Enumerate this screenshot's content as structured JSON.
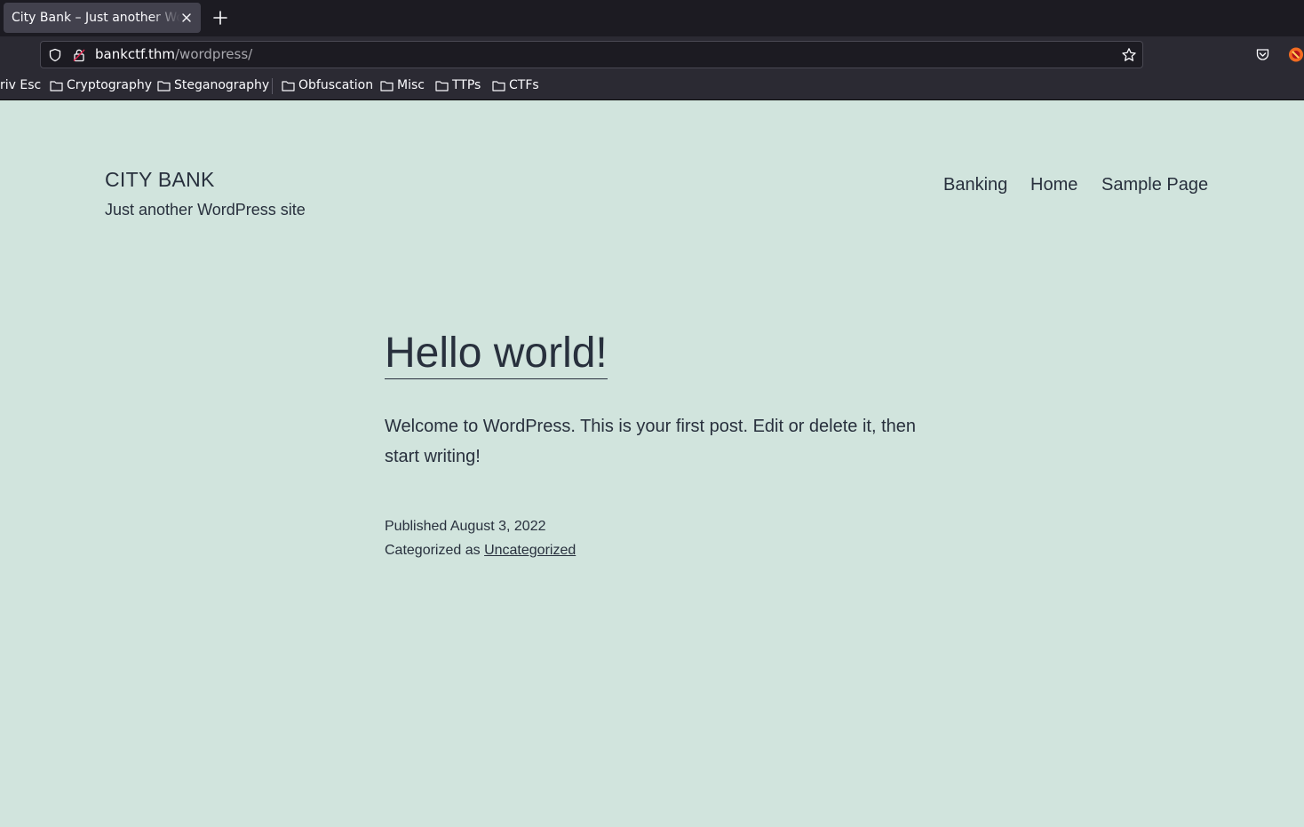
{
  "browser": {
    "tab": {
      "title": "City Bank – Just another WordPress site"
    },
    "url": {
      "host": "bankctf.thm",
      "path": "/wordpress/"
    },
    "bookmarks": [
      "riv Esc",
      "Cryptography",
      "Steganography",
      "Obfuscation",
      "Misc",
      "TTPs",
      "CTFs"
    ],
    "icons": {
      "tab_close": "close-icon",
      "new_tab": "plus-icon",
      "tracking": "shield-icon",
      "security": "lock-icon",
      "bookmark_page": "star-icon",
      "pocket": "pocket-icon",
      "extension": "extension-icon",
      "bookmark_folder": "folder-icon"
    },
    "colors": {
      "tabbar": "#1c1b22",
      "toolbar": "#2b2a33",
      "active_tab": "#42414d"
    }
  },
  "site": {
    "title": "City Bank",
    "description": "Just another WordPress site",
    "menu": [
      "Banking",
      "Home",
      "Sample Page"
    ],
    "colors": {
      "background": "#d1e4dd",
      "text": "#28303d"
    }
  },
  "post": {
    "title": "Hello world!",
    "body": "Welcome to WordPress. This is your first post. Edit or delete it, then start writing!",
    "published_label": "Published",
    "published_date": "August 3, 2022",
    "categorized_label": "Categorized as",
    "category": "Uncategorized"
  }
}
